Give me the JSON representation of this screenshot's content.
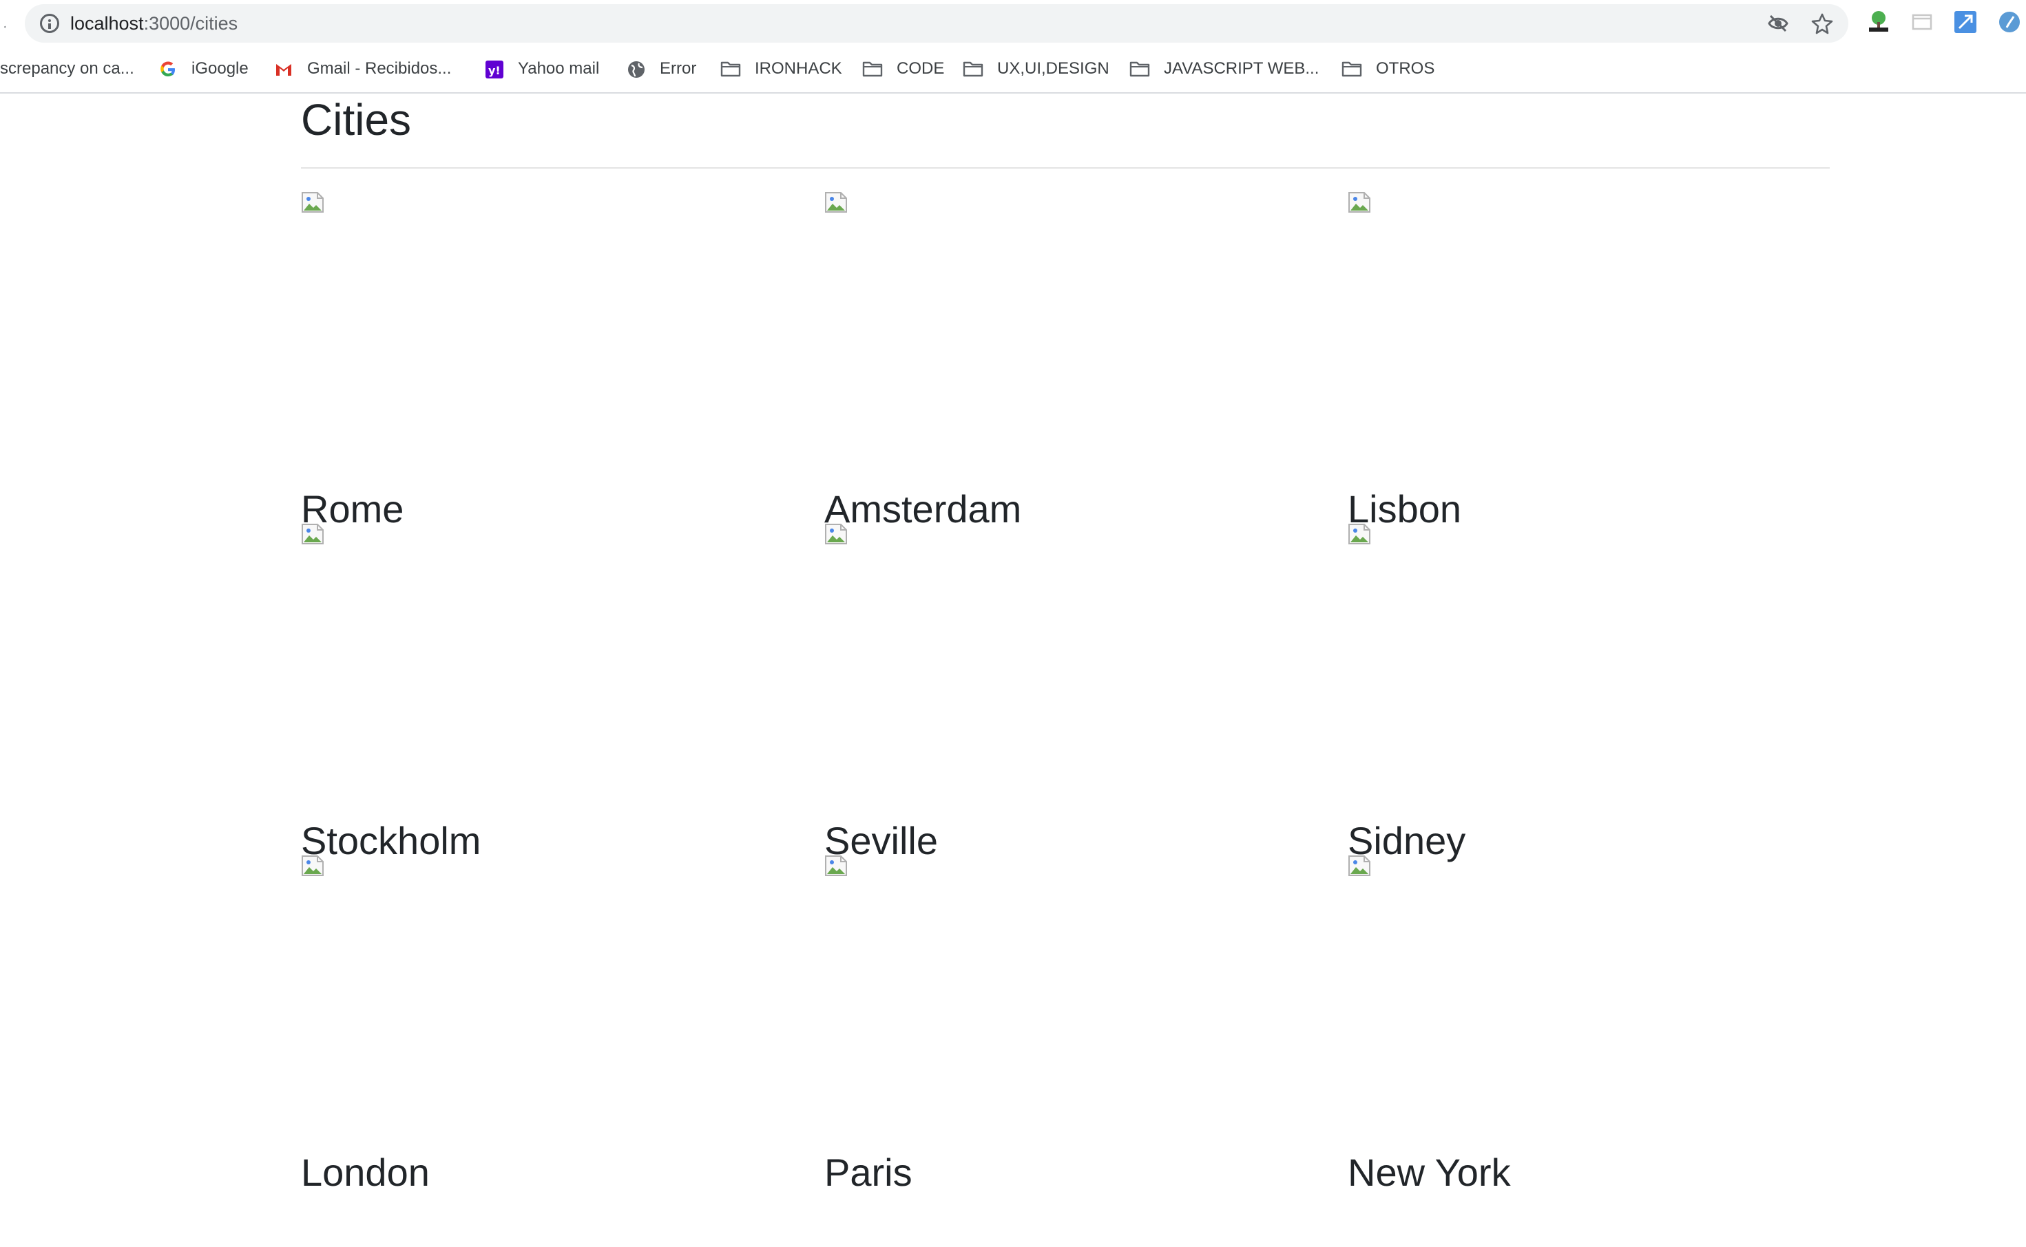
{
  "browser": {
    "url_host": "localhost",
    "url_path": ":3000/cities",
    "omnibox_icons": [
      "eye-slash-icon",
      "star-icon"
    ],
    "extension_icons": [
      "tree-html-icon",
      "window-icon",
      "resize-arrow-icon",
      "circle-extension-icon"
    ]
  },
  "bookmarks": [
    {
      "label": "screpancy on ca...",
      "icon": "none"
    },
    {
      "label": "iGoogle",
      "icon": "google-icon"
    },
    {
      "label": "Gmail - Recibidos...",
      "icon": "gmail-icon"
    },
    {
      "label": "Yahoo mail",
      "icon": "yahoo-icon"
    },
    {
      "label": "Error",
      "icon": "globe-icon"
    },
    {
      "label": "IRONHACK",
      "icon": "folder-icon"
    },
    {
      "label": "CODE",
      "icon": "folder-icon"
    },
    {
      "label": "UX,UI,DESIGN",
      "icon": "folder-icon"
    },
    {
      "label": "JAVASCRIPT WEB...",
      "icon": "folder-icon"
    },
    {
      "label": "OTROS",
      "icon": "folder-icon"
    }
  ],
  "page": {
    "title": "Cities"
  },
  "cities": [
    {
      "name": "Rome"
    },
    {
      "name": "Amsterdam"
    },
    {
      "name": "Lisbon"
    },
    {
      "name": "Stockholm"
    },
    {
      "name": "Seville"
    },
    {
      "name": "Sidney"
    },
    {
      "name": "London"
    },
    {
      "name": "Paris"
    },
    {
      "name": "New York"
    }
  ],
  "colors": {
    "text": "#212529",
    "rule": "#e4e4e4",
    "omnibox_bg": "#f1f3f4"
  }
}
